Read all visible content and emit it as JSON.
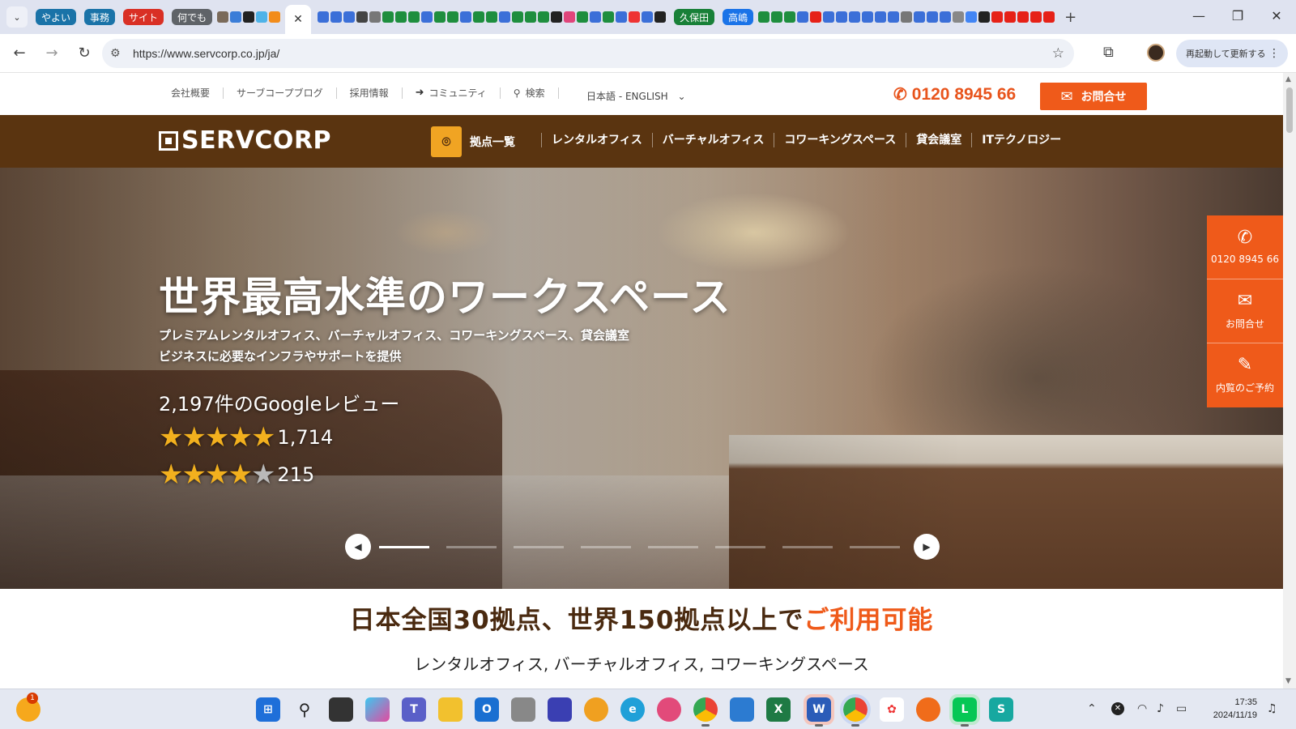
{
  "browser": {
    "tab_groups": [
      {
        "label": "やよい",
        "color": "#1a73a8"
      },
      {
        "label": "事務",
        "color": "#1a73a8"
      },
      {
        "label": "サイト",
        "color": "#d93025"
      },
      {
        "label": "何でも",
        "color": "#5f6368"
      }
    ],
    "tab_groups_right": [
      {
        "label": "久保田",
        "color": "#188038"
      },
      {
        "label": "高嶋",
        "color": "#1a73e8"
      }
    ],
    "url": "https://www.servcorp.co.jp/ja/",
    "update_button": "再起動して更新する"
  },
  "utility_nav": {
    "links": [
      "会社概要",
      "サーブコープブログ",
      "採用情報",
      "コミュニティ",
      "検索"
    ],
    "language": "日本語 - ENGLISH",
    "phone": "0120 8945 66",
    "contact_button": "お問合せ"
  },
  "main_nav": {
    "logo": "SERVCORP",
    "locations": "拠点一覧",
    "items": [
      "レンタルオフィス",
      "バーチャルオフィス",
      "コワーキングスペース",
      "貸会議室",
      "ITテクノロジー"
    ]
  },
  "hero": {
    "title": "世界最高水準のワークスペース",
    "subtitle_line1": "プレミアムレンタルオフィス、バーチャルオフィス、コワーキングスペース、貸会議室",
    "subtitle_line2": "ビジネスに必要なインフラやサポートを提供",
    "reviews_heading": "2,197件のGoogleレビュー",
    "five_star_count": "1,714",
    "four_star_count": "215",
    "slides_total": 8,
    "active_slide": 1
  },
  "side_cta": {
    "phone": "0120 8945 66",
    "contact": "お問合せ",
    "tour": "内覧のご予約"
  },
  "section": {
    "headline_main": "日本全国30拠点、世界150拠点以上で",
    "headline_accent": "ご利用可能",
    "subline": "レンタルオフィス, バーチャルオフィス, コワーキングスペース"
  },
  "taskbar": {
    "time": "17:35",
    "date": "2024/11/19",
    "notification_count": "1"
  },
  "colors": {
    "brand_brown": "#5a3410",
    "accent_orange": "#ef5a1a",
    "pin_yellow": "#f0a423"
  }
}
